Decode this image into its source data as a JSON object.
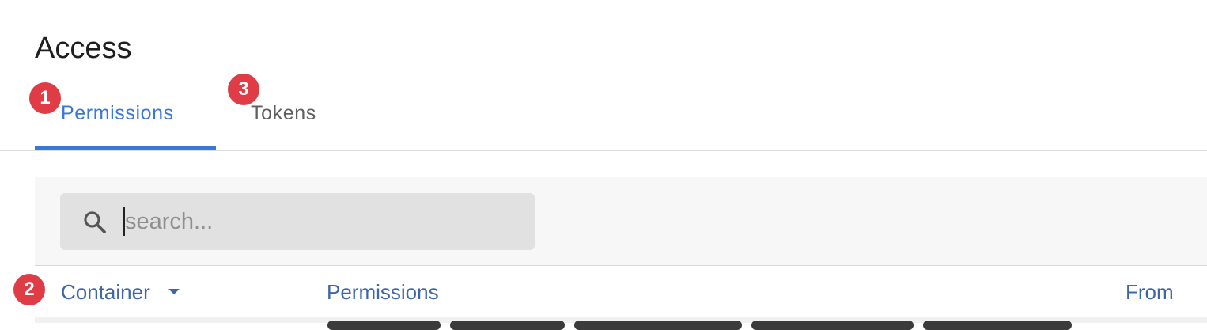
{
  "page": {
    "title": "Access"
  },
  "tabs": [
    {
      "label": "Permissions",
      "active": true
    },
    {
      "label": "Tokens",
      "active": false
    }
  ],
  "search": {
    "placeholder": "search...",
    "value": ""
  },
  "table": {
    "columns": [
      {
        "label": "Container",
        "sorted": "desc"
      },
      {
        "label": "Permissions"
      },
      {
        "label": "From"
      }
    ]
  },
  "annotations": [
    "1",
    "2",
    "3"
  ],
  "colors": {
    "accent": "#3a78d6",
    "header_text": "#3f67a8",
    "badge": "#e03c45",
    "search_bg": "#e1e1e1"
  },
  "icons": {
    "search": "search-icon",
    "sort": "caret-down-icon"
  }
}
